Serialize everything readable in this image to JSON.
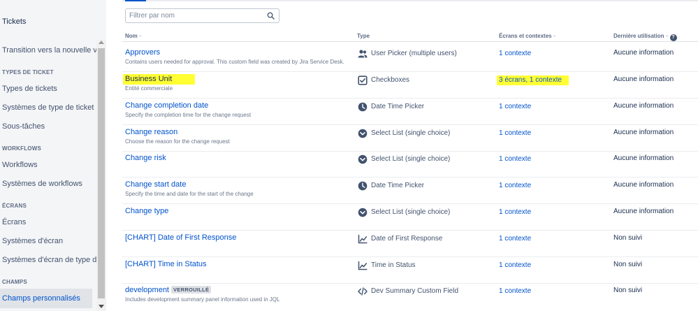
{
  "sidebar": {
    "title": "Tickets",
    "transition_item": "Transition vers la nouvelle v...",
    "sections": [
      {
        "heading": "TYPES DE TICKET",
        "items": [
          "Types de tickets",
          "Systèmes de type de ticket",
          "Sous-tâches"
        ]
      },
      {
        "heading": "WORKFLOWS",
        "items": [
          "Workflows",
          "Systèmes de workflows"
        ]
      },
      {
        "heading": "ÉCRANS",
        "items": [
          "Écrans",
          "Systèmes d'écran",
          "Systèmes d'écran de type d..."
        ]
      },
      {
        "heading": "CHAMPS",
        "items": [
          "Champs personnalisés"
        ]
      }
    ]
  },
  "search": {
    "placeholder": "Filtrer par nom"
  },
  "table": {
    "headers": {
      "name": "Nom",
      "type": "Type",
      "contexts": "Écrans et contextes",
      "last_used": "Dernière utilisation"
    },
    "sort_indicator": "÷",
    "help_glyph": "?",
    "rows": [
      {
        "name": "Approvers",
        "desc": "Contains users needed for approval. This custom field was created by Jira Service Desk.",
        "type_icon": "users-icon",
        "type": "User Picker (multiple users)",
        "contexts": "1 contexte",
        "last_used": "Aucune information"
      },
      {
        "name": "Business Unit",
        "desc": "Entité commerciale",
        "type_icon": "checkbox-icon",
        "type": "Checkboxes",
        "contexts": "3 écrans, 1 contexte",
        "last_used": "Aucune information",
        "highlighted": true
      },
      {
        "name": "Change completion date",
        "desc": "Specify the completion time for the change request",
        "type_icon": "clock-icon",
        "type": "Date Time Picker",
        "contexts": "1 contexte",
        "last_used": "Aucune information"
      },
      {
        "name": "Change reason",
        "desc": "Choose the reason for the change request",
        "type_icon": "chevron-circle-icon",
        "type": "Select List (single choice)",
        "contexts": "1 contexte",
        "last_used": "Aucune information"
      },
      {
        "name": "Change risk",
        "desc": "",
        "type_icon": "chevron-circle-icon",
        "type": "Select List (single choice)",
        "contexts": "1 contexte",
        "last_used": "Aucune information"
      },
      {
        "name": "Change start date",
        "desc": "Specify the time and date for the start of the change",
        "type_icon": "clock-icon",
        "type": "Date Time Picker",
        "contexts": "1 contexte",
        "last_used": "Aucune information"
      },
      {
        "name": "Change type",
        "desc": "",
        "type_icon": "chevron-circle-icon",
        "type": "Select List (single choice)",
        "contexts": "1 contexte",
        "last_used": "Aucune information"
      },
      {
        "name": "[CHART] Date of First Response",
        "desc": "",
        "type_icon": "line-chart-icon",
        "type": "Date of First Response",
        "contexts": "1 contexte",
        "last_used": "Non suivi"
      },
      {
        "name": "[CHART] Time in Status",
        "desc": "",
        "type_icon": "line-chart-icon",
        "type": "Time in Status",
        "contexts": "1 contexte",
        "last_used": "Non suivi"
      },
      {
        "name": "development",
        "lozenge": "VERROUILLÉ",
        "desc": "Includes development summary panel information used in JQL",
        "type_icon": "code-icon",
        "type": "Dev Summary Custom Field",
        "contexts": "1 contexte",
        "last_used": "Non suivi"
      }
    ]
  },
  "colors": {
    "link": "#0052cc",
    "highlight": "#ffff33",
    "sidebar_bg": "#f4f5f7",
    "icon": "#42526e"
  }
}
